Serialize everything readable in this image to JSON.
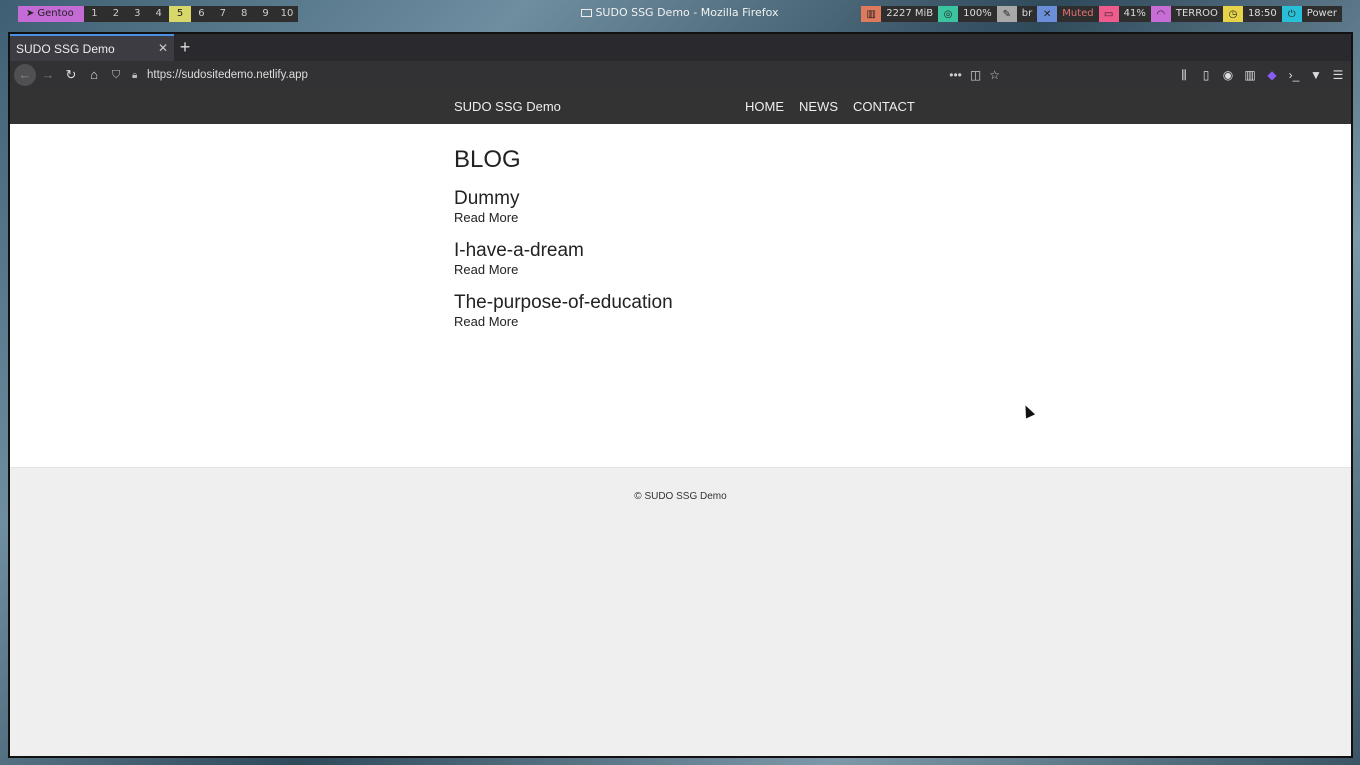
{
  "taskbar": {
    "distro": "Gentoo",
    "workspaces": [
      "1",
      "2",
      "3",
      "4",
      "5",
      "6",
      "7",
      "8",
      "9",
      "10"
    ],
    "active_workspace": "5",
    "window_title": "SUDO SSG Demo - Mozilla Firefox",
    "memory": "2227 MiB",
    "cpu": "100%",
    "keyboard": "br",
    "volume": "Muted",
    "battery": "41%",
    "wifi": "TERROO",
    "time": "18:50",
    "power": "Power"
  },
  "browser": {
    "tab_title": "SUDO SSG Demo",
    "url": "https://sudositedemo.netlify.app"
  },
  "site": {
    "brand": "SUDO SSG Demo",
    "nav": [
      "HOME",
      "NEWS",
      "CONTACT"
    ],
    "heading": "BLOG",
    "posts": [
      {
        "title": "Dummy",
        "link": "Read More"
      },
      {
        "title": "I-have-a-dream",
        "link": "Read More"
      },
      {
        "title": "The-purpose-of-education",
        "link": "Read More"
      }
    ],
    "footer": "© SUDO SSG Demo"
  },
  "colors": {
    "site_header_bg": "#333333",
    "footer_bg": "#efefef",
    "gentoo_badge": "#c56bd6",
    "active_workspace": "#d8d86a"
  }
}
